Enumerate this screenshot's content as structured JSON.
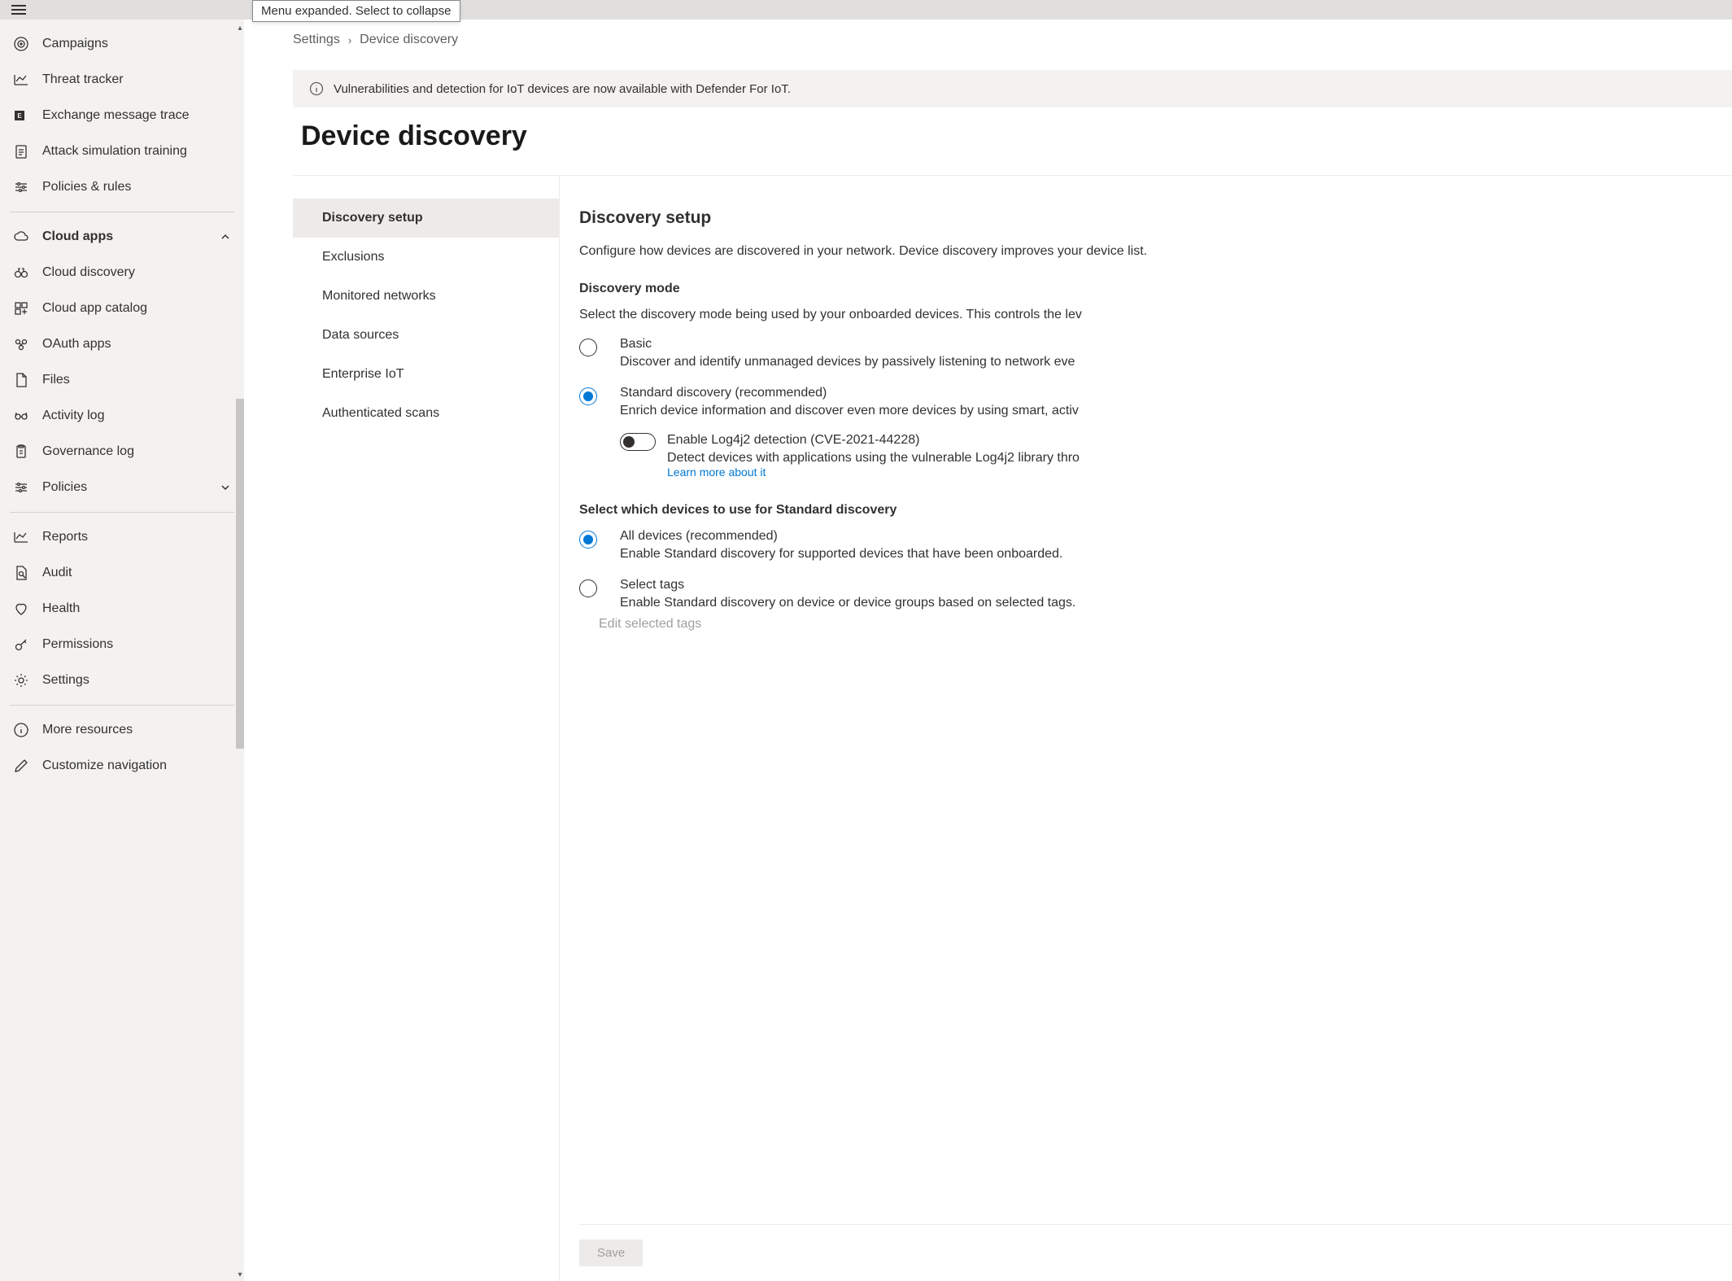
{
  "tooltip": "Menu expanded. Select to collapse",
  "sidebar": {
    "items": [
      {
        "label": "Campaigns",
        "icon": "target"
      },
      {
        "label": "Threat tracker",
        "icon": "line-chart"
      },
      {
        "label": "Exchange message trace",
        "icon": "exchange"
      },
      {
        "label": "Attack simulation training",
        "icon": "clipboard-list"
      },
      {
        "label": "Policies & rules",
        "icon": "sliders"
      }
    ],
    "cloud_apps_label": "Cloud apps",
    "cloud_items": [
      {
        "label": "Cloud discovery",
        "icon": "binoculars"
      },
      {
        "label": "Cloud app catalog",
        "icon": "grid-plus"
      },
      {
        "label": "OAuth apps",
        "icon": "oauth"
      },
      {
        "label": "Files",
        "icon": "file"
      },
      {
        "label": "Activity log",
        "icon": "glasses"
      },
      {
        "label": "Governance log",
        "icon": "clipboard"
      },
      {
        "label": "Policies",
        "icon": "sliders",
        "expandable": true
      }
    ],
    "bottom_items": [
      {
        "label": "Reports",
        "icon": "line-chart"
      },
      {
        "label": "Audit",
        "icon": "audit"
      },
      {
        "label": "Health",
        "icon": "heart"
      },
      {
        "label": "Permissions",
        "icon": "key"
      },
      {
        "label": "Settings",
        "icon": "gear"
      }
    ],
    "footer_items": [
      {
        "label": "More resources",
        "icon": "info"
      },
      {
        "label": "Customize navigation",
        "icon": "pencil"
      }
    ]
  },
  "breadcrumb": {
    "root": "Settings",
    "current": "Device discovery"
  },
  "banner": "Vulnerabilities and detection for IoT devices are now available with Defender For IoT.",
  "page_title": "Device discovery",
  "subnav": [
    "Discovery setup",
    "Exclusions",
    "Monitored networks",
    "Data sources",
    "Enterprise IoT",
    "Authenticated scans"
  ],
  "detail": {
    "title": "Discovery setup",
    "desc": "Configure how devices are discovered in your network. Device discovery improves your device list.",
    "mode_label": "Discovery mode",
    "mode_desc": "Select the discovery mode being used by your onboarded devices. This controls the lev",
    "basic": {
      "title": "Basic",
      "subtitle": "Discover and identify unmanaged devices by passively listening to network eve"
    },
    "standard": {
      "title": "Standard discovery (recommended)",
      "subtitle": "Enrich device information and discover even more devices by using smart, activ"
    },
    "log4j": {
      "title": "Enable Log4j2 detection (CVE-2021-44228)",
      "subtitle": "Detect devices with applications using the vulnerable Log4j2 library thro",
      "link": "Learn more about it"
    },
    "select_devices_label": "Select which devices to use for Standard discovery",
    "all_devices": {
      "title": "All devices (recommended)",
      "subtitle": "Enable Standard discovery for supported devices that have been onboarded."
    },
    "select_tags": {
      "title": "Select tags",
      "subtitle": "Enable Standard discovery on device or device groups based on selected tags."
    },
    "edit_tags": "Edit selected tags",
    "save": "Save"
  }
}
